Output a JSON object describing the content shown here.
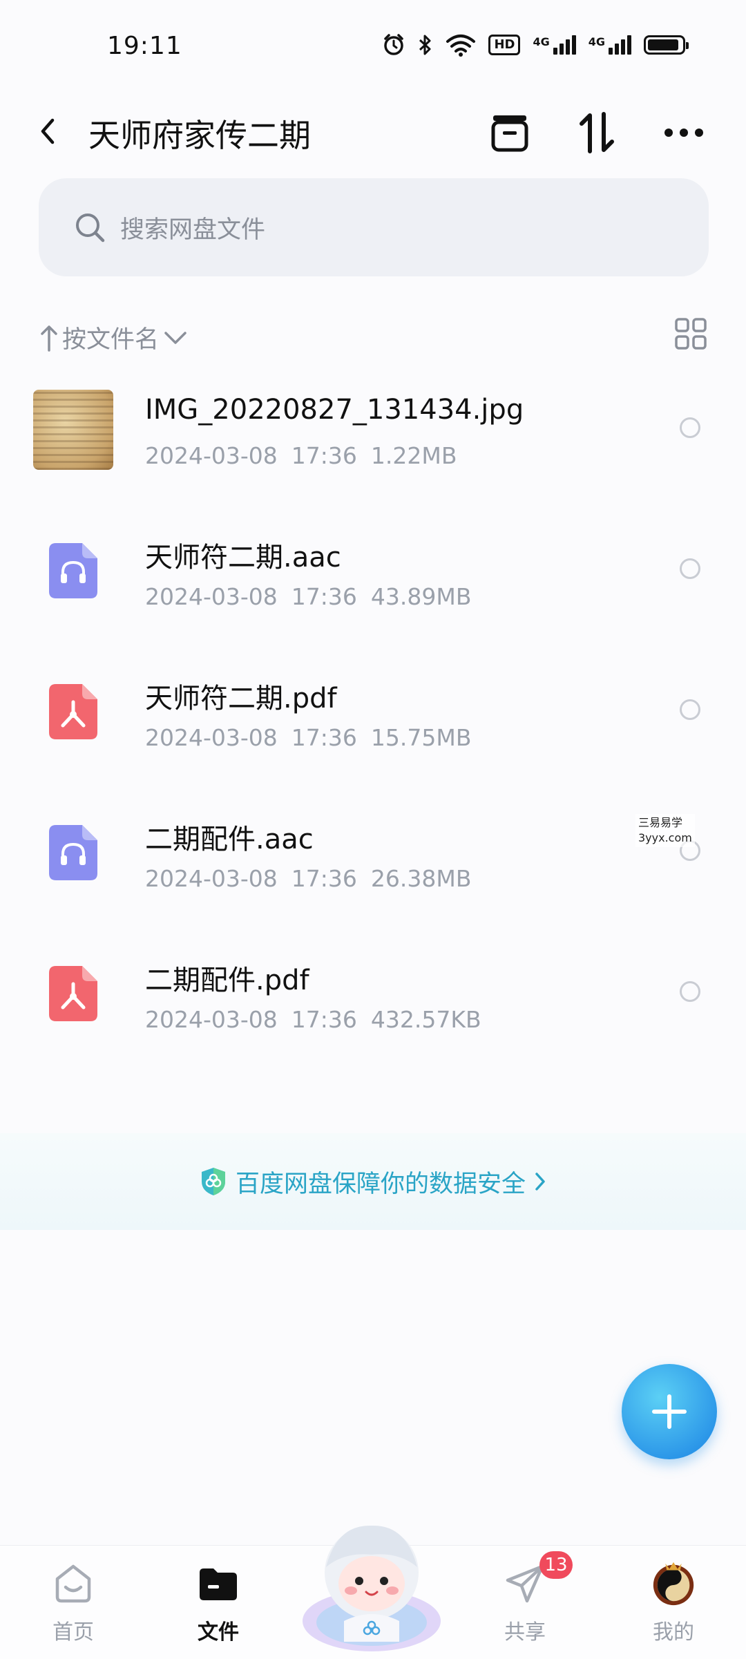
{
  "status_bar": {
    "time": "19:11",
    "hd_label": "HD",
    "network_1": "4G",
    "network_2": "4G"
  },
  "header": {
    "title": "天师府家传二期"
  },
  "search": {
    "placeholder": "搜索网盘文件"
  },
  "sort": {
    "label": "按文件名"
  },
  "files": [
    {
      "name": "IMG_20220827_131434.jpg",
      "date": "2024-03-08",
      "time": "17:36",
      "size": "1.22MB",
      "type": "image"
    },
    {
      "name": "天师符二期.aac",
      "date": "2024-03-08",
      "time": "17:36",
      "size": "43.89MB",
      "type": "audio"
    },
    {
      "name": "天师符二期.pdf",
      "date": "2024-03-08",
      "time": "17:36",
      "size": "15.75MB",
      "type": "pdf"
    },
    {
      "name": "二期配件.aac",
      "date": "2024-03-08",
      "time": "17:36",
      "size": "26.38MB",
      "type": "audio"
    },
    {
      "name": "二期配件.pdf",
      "date": "2024-03-08",
      "time": "17:36",
      "size": "432.57KB",
      "type": "pdf"
    }
  ],
  "watermark": {
    "line1": "三易易学",
    "line2": "3yyx.com"
  },
  "safety_banner": {
    "text": "百度网盘保障你的数据安全"
  },
  "bottom_nav": {
    "home": "首页",
    "files": "文件",
    "share": "共享",
    "share_badge": "13",
    "mine": "我的"
  },
  "colors": {
    "accent": "#2aa4c6",
    "audio_icon": "#8a8ef0",
    "pdf_icon": "#f2666e",
    "badge": "#f04a5c",
    "fab": "#2a95e8"
  }
}
